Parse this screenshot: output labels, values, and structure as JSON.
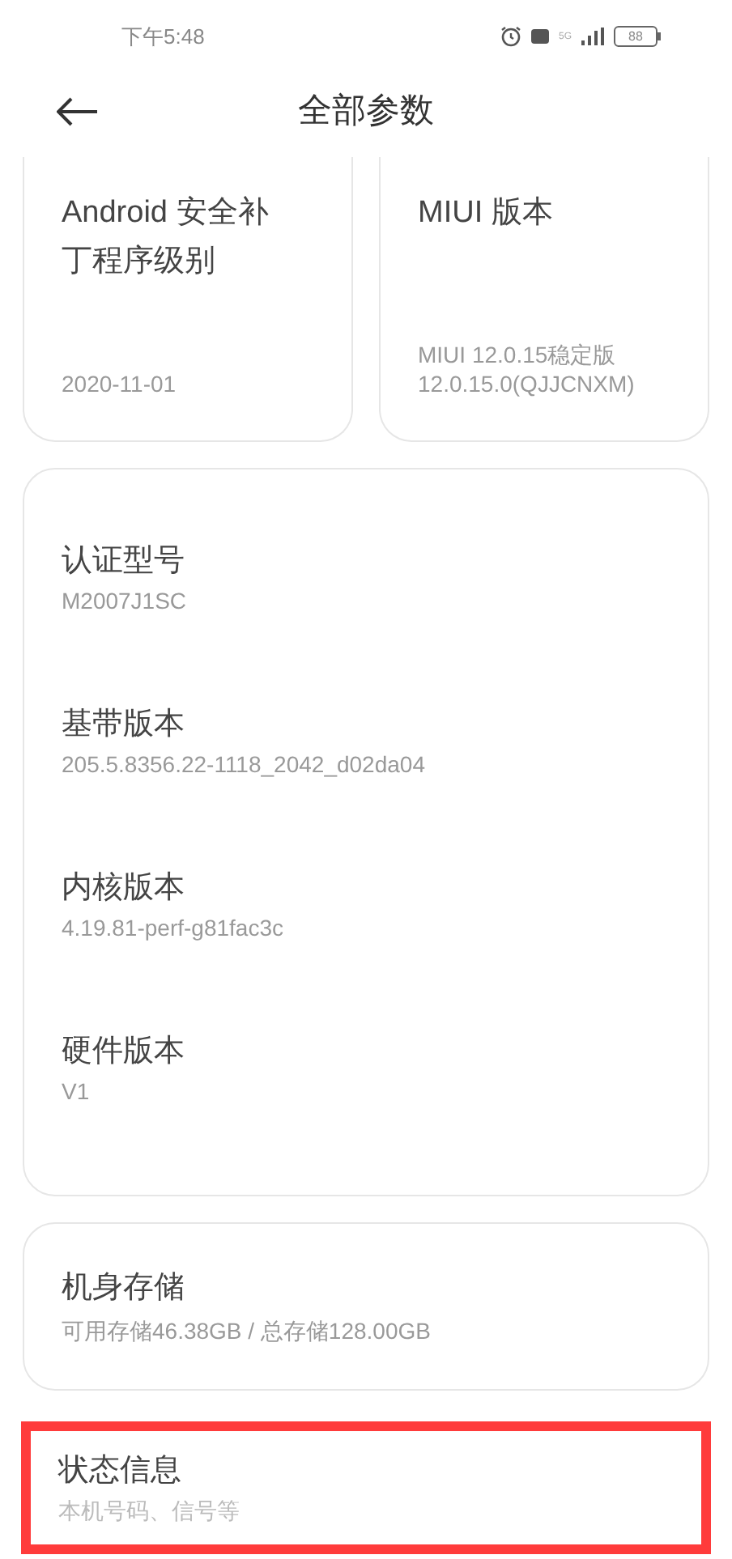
{
  "status_bar": {
    "time": "下午5:48",
    "network": "5G",
    "battery": "88"
  },
  "header": {
    "title": "全部参数"
  },
  "top_cards": [
    {
      "title": "Android 安全补丁程序级别",
      "values": [
        "2020-11-01"
      ]
    },
    {
      "title": "MIUI 版本",
      "values": [
        "MIUI 12.0.15稳定版",
        "12.0.15.0(QJJCNXM)"
      ]
    }
  ],
  "details_card": {
    "items": [
      {
        "label": "认证型号",
        "value": "M2007J1SC"
      },
      {
        "label": "基带版本",
        "value": "205.5.8356.22-1118_2042_d02da04"
      },
      {
        "label": "内核版本",
        "value": "4.19.81-perf-g81fac3c"
      },
      {
        "label": "硬件版本",
        "value": "V1"
      }
    ]
  },
  "storage_card": {
    "label": "机身存储",
    "value": "可用存储46.38GB / 总存储128.00GB"
  },
  "status_card": {
    "label": "状态信息",
    "value": "本机号码、信号等",
    "highlighted": true
  }
}
